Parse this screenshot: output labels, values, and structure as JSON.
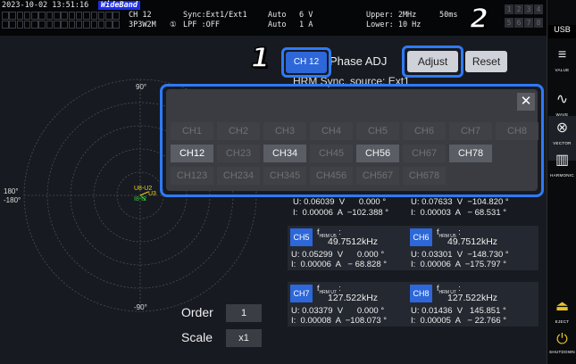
{
  "status": {
    "datetime": "2023-10-02 13:51:16",
    "mode_badge": "WideBand",
    "ch_label": "CH 12",
    "wiring": "3P3W2M",
    "circle_num": "①",
    "sync": "Sync:Ext1/Ext1",
    "lpf": "LPF :OFF",
    "auto1": "Auto",
    "auto2": "Auto",
    "range_v": "6 V",
    "range_a": "1 A",
    "upper": "Upper:  2MHz",
    "lower": "Lower: 10 Hz",
    "interval": "50ms",
    "grid_nums": [
      "1",
      "2",
      "3",
      "4",
      "5",
      "6",
      "7",
      "8"
    ]
  },
  "sidebar": {
    "usb": "USB",
    "value_label": "VALUE",
    "wave_label": "WAVE",
    "vector_label": "VECTOR",
    "harmonic_label": "HARMONIC",
    "eject_label": "EJECT",
    "shutdown_label": "SHUTDOWN"
  },
  "vector": {
    "angle_top": "90°",
    "angle_bottom": "-90°",
    "angle_left1": "180°",
    "angle_left2": "-180°",
    "marker_u": "U8-U2",
    "marker_u3": "U3",
    "marker_i": "I8-I2"
  },
  "phase": {
    "ch_button": "CH 12",
    "title": "Phase ADJ",
    "adjust": "Adjust",
    "reset": "Reset",
    "hrm_sync": "HRM Sync. source: Ext1"
  },
  "annotations": {
    "one": "1",
    "two": "2"
  },
  "popup": {
    "close": "✕",
    "row1": [
      "CH1",
      "CH2",
      "CH3",
      "CH4",
      "CH5",
      "CH6",
      "CH7",
      "CH8"
    ],
    "row2": [
      "CH12",
      "CH23",
      "CH34",
      "CH45",
      "CH56",
      "CH67",
      "CH78"
    ],
    "row3": [
      "CH123",
      "CH234",
      "CH345",
      "CH456",
      "CH567",
      "CH678"
    ]
  },
  "partial_rows": {
    "left_u": "U: 0.06039  V      0.000 °",
    "left_i": "I:  0.00006  A  −102.388 °",
    "right_u": "U: 0.07633  V  −104.820 °",
    "right_i": "I:  0.00003  A   − 68.531 °"
  },
  "cards": [
    {
      "ch": "CH5",
      "freq_label": "f",
      "freq_sub": "HRM U5",
      "freq": "49.7512kHz",
      "u": "U: 0.05299  V      0.000 °",
      "i": "I:  0.00006  A   − 68.828 °"
    },
    {
      "ch": "CH6",
      "freq_label": "f",
      "freq_sub": "HRM U5",
      "freq": "49.7512kHz",
      "u": "U: 0.03301  V  −148.730 °",
      "i": "I:  0.00006  A  −175.797 °"
    },
    {
      "ch": "CH7",
      "freq_label": "f",
      "freq_sub": "HRM U7",
      "freq": "127.522kHz",
      "u": "U: 0.03379  V      0.000 °",
      "i": "I:  0.00008  A  −108.073 °"
    },
    {
      "ch": "CH8",
      "freq_label": "f",
      "freq_sub": "HRM U7",
      "freq": "127.522kHz",
      "u": "U: 0.01436  V   145.851 °",
      "i": "I:  0.00005  A   − 22.766 °"
    }
  ],
  "controls": {
    "order_label": "Order",
    "order_value": "1",
    "scale_label": "Scale",
    "scale_value": "x1"
  },
  "colors": {
    "accent": "#2e7af7",
    "ch_tag": "#2d67d9",
    "marker_u": "#f2d21a",
    "marker_i": "#3ccf3c"
  }
}
